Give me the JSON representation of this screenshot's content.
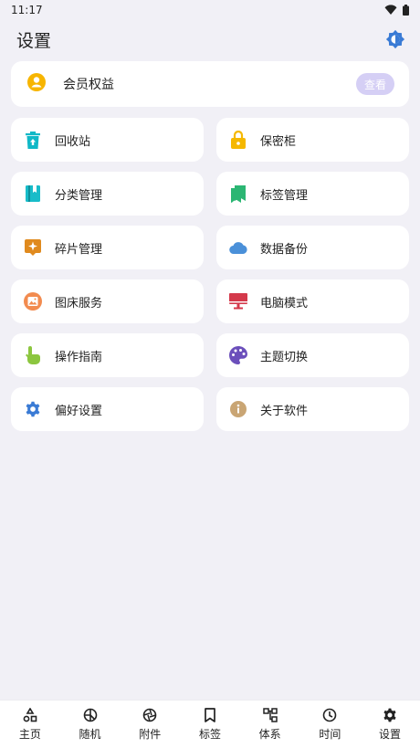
{
  "status_bar": {
    "time": "11:17"
  },
  "header": {
    "title": "设置"
  },
  "member": {
    "label": "会员权益",
    "button": "查看"
  },
  "tiles": [
    {
      "label": "回收站",
      "icon": "trash-icon",
      "color": "#10b8c7"
    },
    {
      "label": "保密柜",
      "icon": "lock-icon",
      "color": "#f5b800"
    },
    {
      "label": "分类管理",
      "icon": "book-icon",
      "color": "#18bcc9"
    },
    {
      "label": "标签管理",
      "icon": "bookmarks-icon",
      "color": "#2bb673"
    },
    {
      "label": "碎片管理",
      "icon": "sparkle-icon",
      "color": "#e08a1e"
    },
    {
      "label": "数据备份",
      "icon": "cloud-icon",
      "color": "#4a90d9"
    },
    {
      "label": "图床服务",
      "icon": "image-icon",
      "color": "#f28b4f"
    },
    {
      "label": "电脑模式",
      "icon": "monitor-icon",
      "color": "#d4394b"
    },
    {
      "label": "操作指南",
      "icon": "hand-pointer-icon",
      "color": "#8cc63f"
    },
    {
      "label": "主题切换",
      "icon": "palette-icon",
      "color": "#6b4fbb"
    },
    {
      "label": "偏好设置",
      "icon": "gear-icon",
      "color": "#3a7bd5"
    },
    {
      "label": "关于软件",
      "icon": "info-icon",
      "color": "#c9a574"
    }
  ],
  "nav": [
    {
      "label": "主页",
      "icon": "shapes-icon"
    },
    {
      "label": "随机",
      "icon": "random-icon"
    },
    {
      "label": "附件",
      "icon": "aperture-icon"
    },
    {
      "label": "标签",
      "icon": "bookmark-icon"
    },
    {
      "label": "体系",
      "icon": "hierarchy-icon"
    },
    {
      "label": "时间",
      "icon": "clock-icon"
    },
    {
      "label": "设置",
      "icon": "settings-icon"
    }
  ],
  "colors": {
    "accent": "#3a7bd5",
    "member_icon": "#f7b500",
    "view_button": "#d5cff5",
    "background": "#f1f0f6"
  }
}
